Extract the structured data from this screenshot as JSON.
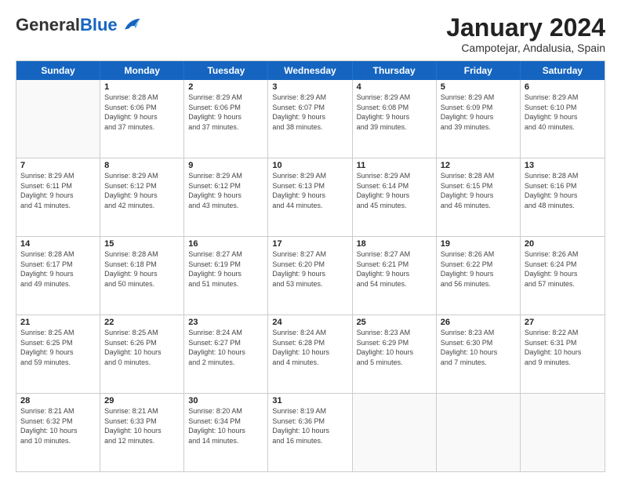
{
  "logo": {
    "general": "General",
    "blue": "Blue"
  },
  "title": "January 2024",
  "location": "Campotejar, Andalusia, Spain",
  "header_days": [
    "Sunday",
    "Monday",
    "Tuesday",
    "Wednesday",
    "Thursday",
    "Friday",
    "Saturday"
  ],
  "weeks": [
    [
      {
        "day": null,
        "info": null
      },
      {
        "day": "1",
        "info": "Sunrise: 8:28 AM\nSunset: 6:06 PM\nDaylight: 9 hours\nand 37 minutes."
      },
      {
        "day": "2",
        "info": "Sunrise: 8:29 AM\nSunset: 6:06 PM\nDaylight: 9 hours\nand 37 minutes."
      },
      {
        "day": "3",
        "info": "Sunrise: 8:29 AM\nSunset: 6:07 PM\nDaylight: 9 hours\nand 38 minutes."
      },
      {
        "day": "4",
        "info": "Sunrise: 8:29 AM\nSunset: 6:08 PM\nDaylight: 9 hours\nand 39 minutes."
      },
      {
        "day": "5",
        "info": "Sunrise: 8:29 AM\nSunset: 6:09 PM\nDaylight: 9 hours\nand 39 minutes."
      },
      {
        "day": "6",
        "info": "Sunrise: 8:29 AM\nSunset: 6:10 PM\nDaylight: 9 hours\nand 40 minutes."
      }
    ],
    [
      {
        "day": "7",
        "info": "Sunrise: 8:29 AM\nSunset: 6:11 PM\nDaylight: 9 hours\nand 41 minutes."
      },
      {
        "day": "8",
        "info": "Sunrise: 8:29 AM\nSunset: 6:12 PM\nDaylight: 9 hours\nand 42 minutes."
      },
      {
        "day": "9",
        "info": "Sunrise: 8:29 AM\nSunset: 6:12 PM\nDaylight: 9 hours\nand 43 minutes."
      },
      {
        "day": "10",
        "info": "Sunrise: 8:29 AM\nSunset: 6:13 PM\nDaylight: 9 hours\nand 44 minutes."
      },
      {
        "day": "11",
        "info": "Sunrise: 8:29 AM\nSunset: 6:14 PM\nDaylight: 9 hours\nand 45 minutes."
      },
      {
        "day": "12",
        "info": "Sunrise: 8:28 AM\nSunset: 6:15 PM\nDaylight: 9 hours\nand 46 minutes."
      },
      {
        "day": "13",
        "info": "Sunrise: 8:28 AM\nSunset: 6:16 PM\nDaylight: 9 hours\nand 48 minutes."
      }
    ],
    [
      {
        "day": "14",
        "info": "Sunrise: 8:28 AM\nSunset: 6:17 PM\nDaylight: 9 hours\nand 49 minutes."
      },
      {
        "day": "15",
        "info": "Sunrise: 8:28 AM\nSunset: 6:18 PM\nDaylight: 9 hours\nand 50 minutes."
      },
      {
        "day": "16",
        "info": "Sunrise: 8:27 AM\nSunset: 6:19 PM\nDaylight: 9 hours\nand 51 minutes."
      },
      {
        "day": "17",
        "info": "Sunrise: 8:27 AM\nSunset: 6:20 PM\nDaylight: 9 hours\nand 53 minutes."
      },
      {
        "day": "18",
        "info": "Sunrise: 8:27 AM\nSunset: 6:21 PM\nDaylight: 9 hours\nand 54 minutes."
      },
      {
        "day": "19",
        "info": "Sunrise: 8:26 AM\nSunset: 6:22 PM\nDaylight: 9 hours\nand 56 minutes."
      },
      {
        "day": "20",
        "info": "Sunrise: 8:26 AM\nSunset: 6:24 PM\nDaylight: 9 hours\nand 57 minutes."
      }
    ],
    [
      {
        "day": "21",
        "info": "Sunrise: 8:25 AM\nSunset: 6:25 PM\nDaylight: 9 hours\nand 59 minutes."
      },
      {
        "day": "22",
        "info": "Sunrise: 8:25 AM\nSunset: 6:26 PM\nDaylight: 10 hours\nand 0 minutes."
      },
      {
        "day": "23",
        "info": "Sunrise: 8:24 AM\nSunset: 6:27 PM\nDaylight: 10 hours\nand 2 minutes."
      },
      {
        "day": "24",
        "info": "Sunrise: 8:24 AM\nSunset: 6:28 PM\nDaylight: 10 hours\nand 4 minutes."
      },
      {
        "day": "25",
        "info": "Sunrise: 8:23 AM\nSunset: 6:29 PM\nDaylight: 10 hours\nand 5 minutes."
      },
      {
        "day": "26",
        "info": "Sunrise: 8:23 AM\nSunset: 6:30 PM\nDaylight: 10 hours\nand 7 minutes."
      },
      {
        "day": "27",
        "info": "Sunrise: 8:22 AM\nSunset: 6:31 PM\nDaylight: 10 hours\nand 9 minutes."
      }
    ],
    [
      {
        "day": "28",
        "info": "Sunrise: 8:21 AM\nSunset: 6:32 PM\nDaylight: 10 hours\nand 10 minutes."
      },
      {
        "day": "29",
        "info": "Sunrise: 8:21 AM\nSunset: 6:33 PM\nDaylight: 10 hours\nand 12 minutes."
      },
      {
        "day": "30",
        "info": "Sunrise: 8:20 AM\nSunset: 6:34 PM\nDaylight: 10 hours\nand 14 minutes."
      },
      {
        "day": "31",
        "info": "Sunrise: 8:19 AM\nSunset: 6:36 PM\nDaylight: 10 hours\nand 16 minutes."
      },
      {
        "day": null,
        "info": null
      },
      {
        "day": null,
        "info": null
      },
      {
        "day": null,
        "info": null
      }
    ]
  ]
}
